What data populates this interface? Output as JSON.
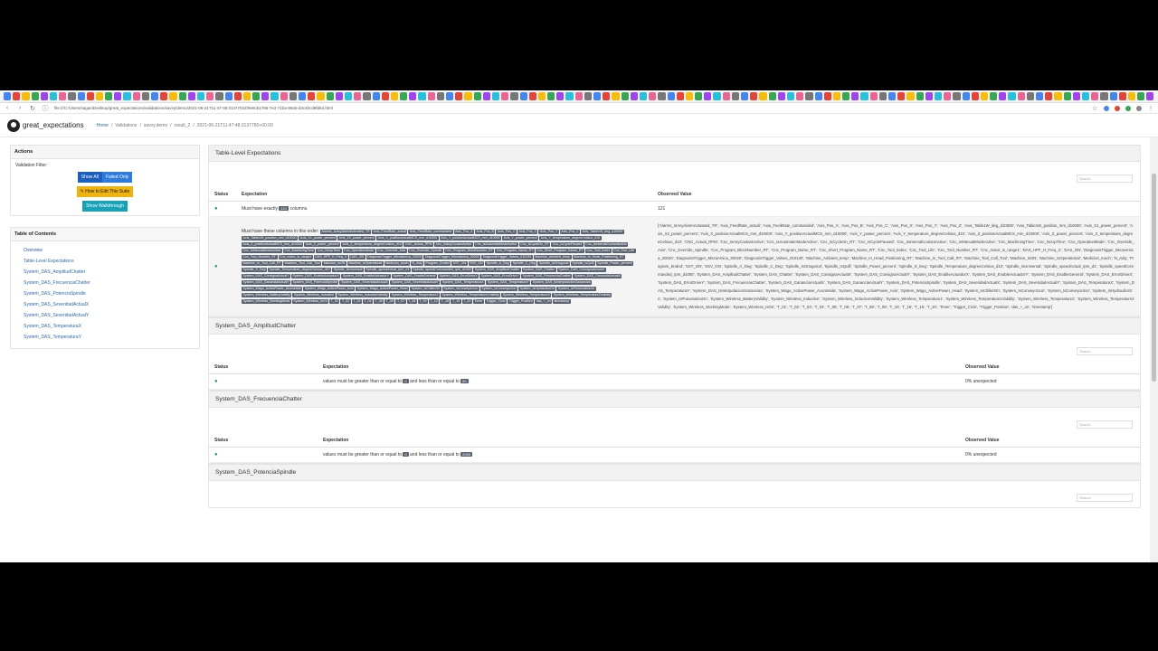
{
  "browser": {
    "url": "file:///C:/Users/sagan/Desktop/great_expectations/validations/savvy/demo/2021-06-21T11-47-48.0137702Z/9e6cb1786-7e2-71ba-95a0-d4c4bcd8fd64.html"
  },
  "app": {
    "brand": "great_expectations",
    "breadcrumbs": [
      "Home",
      "/",
      "Validations",
      "/",
      "savvy.demo",
      "/",
      "result_2",
      "/",
      "2021-06-21T11:47:48.0137780+00:00"
    ]
  },
  "sidebar": {
    "actions_title": "Actions",
    "validation_filter_label": "Validation Filter:",
    "show_all": "Show All",
    "failed_only": "Failed Only",
    "edit_suite": "How to Edit This Suite",
    "walkthrough": "Show Walkthrough",
    "toc_title": "Table of Contents",
    "toc_items": [
      "Overview",
      "Table-Level Expectations",
      "System_DAS_AmplitudChatter",
      "System_DAS_FrecuenciaChatter",
      "System_DAS_PotenciaSpindle",
      "System_DAS_SeveridadActualX",
      "System_DAS_SeveridadActualY",
      "System_DAS_TemperaturaX",
      "System_DAS_TemperaturaY"
    ]
  },
  "table_level": {
    "title": "Table-Level Expectations",
    "search_placeholder": "Search",
    "headers": [
      "Status",
      "Expectation",
      "Observed Value"
    ],
    "row1": {
      "prefix": "Must have exactly",
      "value": "121",
      "suffix": "columns.",
      "observed": "121"
    },
    "row2": {
      "prefix": "Must have these columns in this order:",
      "columns": [
        "Alarms_IsAnyAlarmActivated_TR",
        "Axis_FeedRate_actual",
        "Axis_FeedRate_commanded",
        "Axis_Pos_A",
        "Axis_Pos_B",
        "Axis_Pos_C",
        "Axis_Pos_X",
        "Axis_Pos_Y",
        "Axis_Pos_Z",
        "Axis_Table1W_deg_d10000",
        "Axis_Table1W_position_mm_d10000",
        "Axis_X1_power_percent",
        "Axis_X2_power_percent",
        "Axis_X_positionActualMCS_mm_d10000",
        "Axis_Y_positionActualMCS_mm_d10000",
        "Axis_Y_power_percent",
        "Axis_Y_temperature_degreeCelsius_d10",
        "Axis_Z_positionActualMCS_mm_d10000",
        "Axis_Z_power_percent",
        "Axis_Z_temperature_degreeCelsius_d10",
        "CNC_Actual_RPM",
        "Cnc_IsAnyCoolantActive",
        "Cnc_IsAutomaticModeActive",
        "Cnc_IsCycleOn_RT",
        "Cnc_IsCyclePaused",
        "Cnc_IsInternalCoolantActive",
        "Cnc_IsManualModeActive",
        "Cnc_MachiningTime",
        "Cnc_NcUpTime",
        "Cnc_OperationMode",
        "Cnc_Override_Axis",
        "Cnc_Override_Spindle",
        "Cnc_Program_BlockNumber_RT",
        "Cnc_Program_Name_RT",
        "Cnc_Short_Program_Name_RT",
        "Cnc_Tool_Index",
        "Cnc_Tool_Life",
        "Cnc_Tool_Number_RT",
        "Cnc_motor_is_range1",
        "DAS_HPF_H_Freq_X",
        "DAS_ON",
        "DiagnosisTrigger_MicraAmica_20020",
        "DiagnosisTrigger_MicraAmica_30020",
        "DiagnosisTrigger_Valves_010130",
        "Machine_Ambient_temp",
        "Machine_In_Head_Positioning_RT",
        "Machine_In_Tool_Call_RT",
        "Machine_Tool_Call_Tool",
        "Machine_IsON",
        "Machine_IsOperational",
        "Medicion_touch",
        "N_Adq",
        "Program_Ended",
        "SST_ON",
        "SSV_ON",
        "Spindle_A_Deg",
        "Spindle_C_Deg",
        "Spindle_IsOrtogonal",
        "Spindle_IsQuill",
        "Spindle_Power_percent",
        "Spindle_S_Deg",
        "Spindle_Temperature_degreeCelsius_d10",
        "Spindle_IsUniversal",
        "Spindle_speedActual_rpm_d1",
        "Spindle_speedCommanded_rpm_d1000",
        "System_DAS_AmplitudChatter",
        "System_DAS_Chatter",
        "System_DAS_ConsignaActualX",
        "System_DAS_ConsignaActualY",
        "System_DAS_EnableActuadorX",
        "System_DAS_EnableActuadorY",
        "System_DAS_EnableGeneral",
        "System_DAS_ErrorDriveX",
        "System_DAS_ErrorDriveY",
        "System_DAS_FrecuenciaChatter",
        "System_DAS_GananciaActualX",
        "System_DAS_GananciaActualY",
        "System_DAS_PotenciaSpindle",
        "System_DAS_SeveridadActualX",
        "System_DAS_SeveridadActualY",
        "System_DAS_TemperaturaX",
        "System_DAS_TemperaturaY",
        "System_DAS_IsInterpolacionGanancias",
        "System_Wago_ActivePower_Acometida",
        "System_Wago_ActivePower_Axis",
        "System_Wago_ActivePower_Head",
        "System_IsChillerOn",
        "System_IsConveyor1on",
        "System_IsConveyor2on",
        "System_IsHydraulicsOn",
        "System_IsPneumaticsOn",
        "System_Wireless_BatteryValidity",
        "System_Wireless_Inductive",
        "System_Wireless_InductiveValidity",
        "System_Wireless_Temperature1",
        "System_Wireless_Temperature1Validity",
        "System_Wireless_Temperature2",
        "System_Wireless_Temperature2Validity",
        "System_Wireless_WorkingMode",
        "System_Wireless_IsOn",
        "T_01",
        "T_02",
        "T_03",
        "T_04",
        "T_05",
        "T_06",
        "T_07",
        "T_08",
        "T_09",
        "T_10",
        "T_18",
        "T_19",
        "T_20",
        "Timer",
        "Trigger_Ciclo",
        "Trigger_Position",
        "das_+_on",
        "timestamp"
      ]
    },
    "row2_observed": "['Alarms_IsAnyAlarmActivated_TR', 'Axis_FeedRate_actual', 'Axis_FeedRate_commanded', 'Axis_Pos_A', 'Axis_Pos_B', 'Axis_Pos_C', 'Axis_Pos_X', 'Axis_Pos_Y', 'Axis_Pos_Z', 'Axis_Table1W_deg_d10000', 'Axis_Table1W_position_mm_d10000', 'Axis_X1_power_percent', 'Axis_X2_power_percent', 'Axis_X_positionActualMCS_mm_d10000', 'Axis_Y_positionActualMCS_mm_d10000', 'Axis_Y_power_percent', 'Axis_Y_temperature_degreeCelsius_d10', 'Axis_Z_positionActualMCS_mm_d10000', 'Axis_Z_power_percent', 'Axis_Z_temperature_degreeCelsius_d10', 'CNC_Actual_RPM', 'Cnc_IsAnyCoolantActive', 'Cnc_IsAutomaticModeActive', 'Cnc_IsCycleOn_RT', 'Cnc_IsCyclePaused', 'Cnc_IsInternalCoolantActive', 'Cnc_IsManualModeActive', 'Cnc_MachiningTime', 'Cnc_NcUpTime', 'Cnc_OperationMode', 'Cnc_Override_Axis', 'Cnc_Override_Spindle', 'Cnc_Program_BlockNumber_RT', 'Cnc_Program_Name_RT', 'Cnc_Short_Program_Name_RT', 'Cnc_Tool_Index', 'Cnc_Tool_Life', 'Cnc_Tool_Number_RT', 'Cnc_motor_is_range1', 'DAS_HPF_H_Freq_X', 'DAS_ON', 'DiagnosisTrigger_MicraAmica_20020', 'DiagnosisTrigger_MicraAmica_30020', 'DiagnosisTrigger_Valves_010130', 'Machine_Ambient_temp', 'Machine_In_Head_Positioning_RT', 'Machine_In_Tool_Call_RT', 'Machine_Tool_Call_Tool', 'Machine_IsON', 'Machine_IsOperational', 'Medicion_touch', 'N_Adq', 'Program_Ended', 'SST_ON', 'SSV_ON', 'Spindle_A_Deg', 'Spindle_C_Deg', 'Spindle_IsOrtogonal', 'Spindle_IsQuill', 'Spindle_Power_percent', 'Spindle_S_Deg', 'Spindle_Temperature_degreeCelsius_d10', 'Spindle_IsUniversal', 'Spindle_speedActual_rpm_d1', 'Spindle_speedCommanded_rpm_d1000', 'System_DAS_AmplitudChatter', 'System_DAS_Chatter', 'System_DAS_ConsignaActualX', 'System_DAS_ConsignaActualY', 'System_DAS_EnableActuadorX', 'System_DAS_EnableActuadorY', 'System_DAS_EnableGeneral', 'System_DAS_ErrorDriveX', 'System_DAS_ErrorDriveY', 'System_DAS_FrecuenciaChatter', 'System_DAS_GananciaActualX', 'System_DAS_GananciaActualY', 'System_DAS_PotenciaSpindle', 'System_DAS_SeveridadActualX', 'System_DAS_SeveridadActualY', 'System_DAS_TemperaturaX', 'System_DAS_TemperaturaY', 'System_DAS_IsInterpolacionGanancias', 'System_Wago_ActivePower_Acometida', 'System_Wago_ActivePower_Axis', 'System_Wago_ActivePower_Head', 'System_IsChillerOn', 'System_IsConveyor1on', 'System_IsConveyor2on', 'System_IsHydraulicsOn', 'System_IsPneumaticsOn', 'System_Wireless_BatteryValidity', 'System_Wireless_Inductive', 'System_Wireless_InductiveValidity', 'System_Wireless_Temperature1', 'System_Wireless_Temperature1Validity', 'System_Wireless_Temperature2', 'System_Wireless_Temperature2Validity', 'System_Wireless_WorkingMode', 'System_Wireless_IsOn', 'T_01', 'T_02', 'T_03', 'T_04', 'T_05', 'T_06', 'T_07', 'T_08', 'T_09', 'T_10', 'T_18', 'T_19', 'T_20', 'Timer', 'Trigger_Ciclo', 'Trigger_Position', 'das_+_on', 'timestamp']"
  },
  "sections": [
    {
      "title": "System_DAS_AmplitudChatter",
      "search_placeholder": "Search",
      "headers": [
        "Status",
        "Expectation",
        "Observed Value"
      ],
      "exp_prefix": "values must be greater than or equal to",
      "min": "0",
      "mid": "and less than or equal to",
      "max": "50",
      "observed": "0% unexpected"
    },
    {
      "title": "System_DAS_FrecuenciaChatter",
      "search_placeholder": "Search",
      "headers": [
        "Status",
        "Expectation",
        "Observed Value"
      ],
      "exp_prefix": "values must be greater than or equal to",
      "min": "0",
      "mid": "and less than or equal to",
      "max": "2000",
      "observed": "0% unexpected"
    },
    {
      "title": "System_DAS_PotenciaSpindle",
      "search_placeholder": "Search"
    }
  ],
  "colors": {
    "success": "#1e9e3a",
    "link": "#2a6ab5",
    "tag": "#5a6270"
  }
}
